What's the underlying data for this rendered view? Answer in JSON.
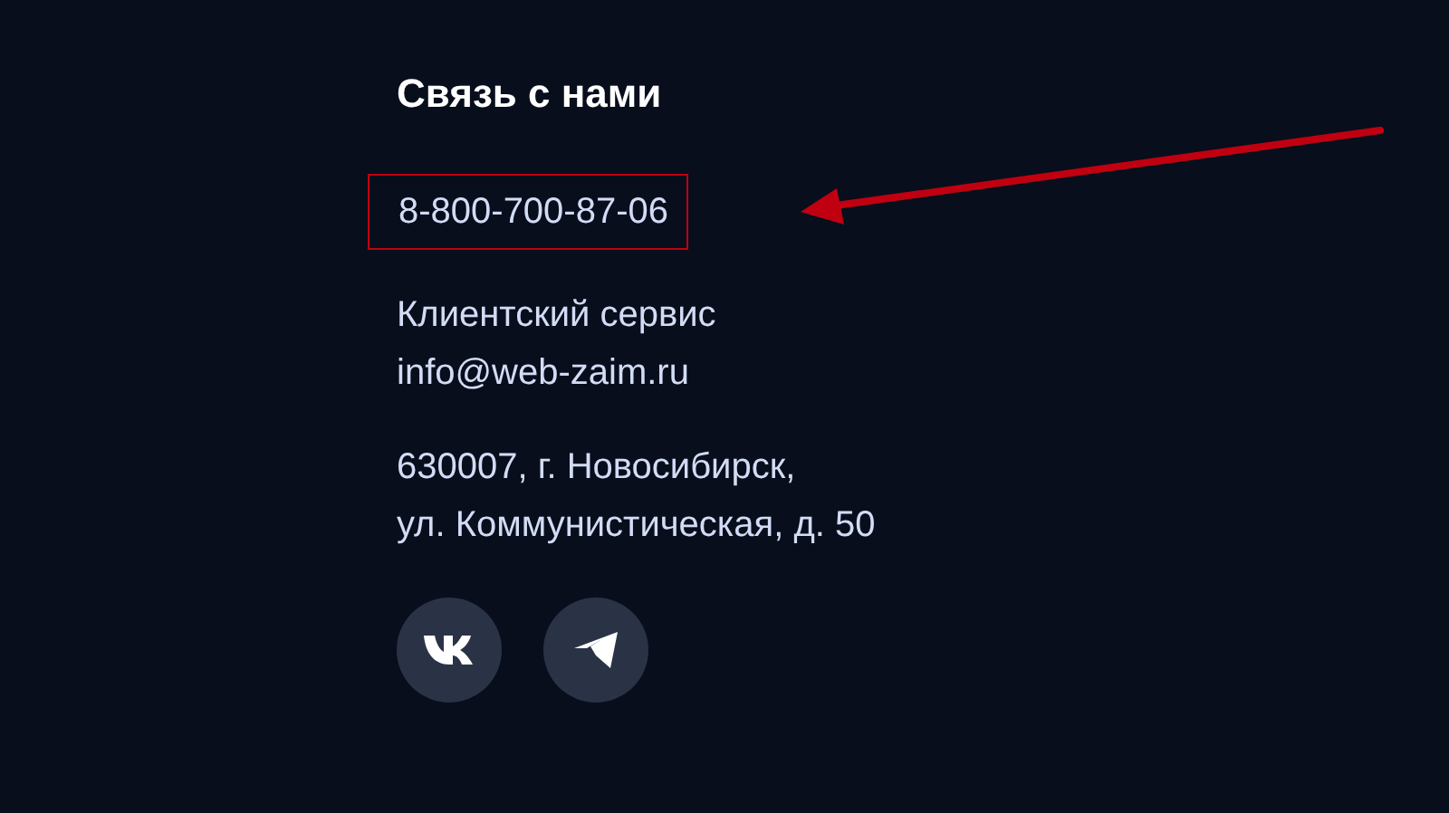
{
  "contacts": {
    "heading": "Связь с нами",
    "phone": {
      "text": "8-800-700-87-06",
      "highlighted": true
    },
    "service": {
      "label": "Клиентский сервис",
      "email": "info@web-zaim.ru"
    },
    "address": [
      "630007, г. Новосибирск,",
      "ул. Коммунистическая, д. 50"
    ],
    "socials": [
      {
        "kind": "vk"
      },
      {
        "kind": "telegram"
      }
    ]
  }
}
